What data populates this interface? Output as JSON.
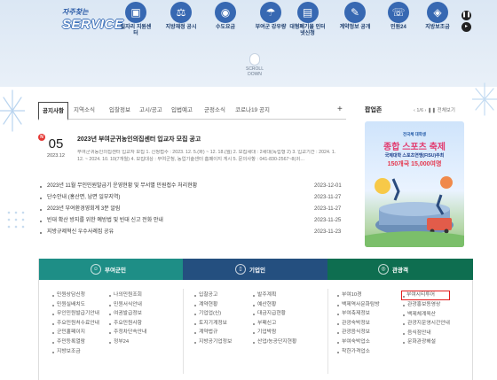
{
  "service": {
    "logo_small": "자주찾는",
    "logo_big": "SERVICE",
    "items": [
      {
        "label": "일자리 지원센터",
        "icon": "briefcase-icon",
        "glyph": "▣"
      },
      {
        "label": "지방재정 공시",
        "icon": "gavel-icon",
        "glyph": "⚖"
      },
      {
        "label": "수도요금",
        "icon": "water-icon",
        "glyph": "◉"
      },
      {
        "label": "부여군 강우량",
        "icon": "rain-icon",
        "glyph": "☂"
      },
      {
        "label": "대형폐기물 인터넷신청",
        "icon": "trash-icon",
        "glyph": "▤"
      },
      {
        "label": "계약정보 공개",
        "icon": "contract-icon",
        "glyph": "✎"
      },
      {
        "label": "민원24",
        "icon": "headset-icon",
        "glyph": "☏"
      },
      {
        "label": "지방보조금",
        "icon": "coin-icon",
        "glyph": "◈"
      }
    ],
    "scroll_label": "SCROLL DOWN",
    "pause_glyph": "❚❚",
    "next_glyph": "▸"
  },
  "notice": {
    "tabs": [
      "공지사항",
      "지역소식",
      "입찰정보",
      "고시/공고",
      "입법예고",
      "군정소식",
      "코로나19 공지"
    ],
    "plus": "+",
    "featured": {
      "badge": "N",
      "day": "05",
      "year_month": "2023.12",
      "title": "2023년 부여군귀농인의집센터 입교자 모집 공고",
      "summary": "부여군귀농인의집센터 입교자 모집 1. 신청접수 : 2023. 12. 5.(화) ~ 12. 18.(월) 2. 모집세대 : 2세대(독립형 2) 3. 입교기간 : 2024. 1. 12. ~ 2024. 10. 10(7개월) 4. 모집대상 : 부여군청, 농업기술센터 홈페이지 게시 5. 문의사항 : 041-830-2567~8(귀…"
    },
    "items": [
      {
        "title": "2023년 11월 무인민원발급기 운영현황 및 무서별 민원접수 처리현황",
        "date": "2023-12-01"
      },
      {
        "title": "단수안내 (홍산면, 남면 일부지역)",
        "date": "2023-11-27"
      },
      {
        "title": "2023년 부여환경영회계 3분 알림",
        "date": "2023-11-27"
      },
      {
        "title": "빈대 확산 방지를 위한 예방법 및 빈대 신고 전화 안내",
        "date": "2023-11-25"
      },
      {
        "title": "지방규제혁신 우수사례집 공유",
        "date": "2023-11-23"
      }
    ]
  },
  "popup": {
    "title": "팝업존",
    "nav": "‹ 1/6 › ❚❚ 전체보기",
    "sub": "전국체 대학생",
    "headline": "종합 스포츠 축제",
    "line": "국제대학 스포츠연맹(FISU)주최",
    "prize": "150개국 15,000여명",
    "colors": {
      "pink": "#e23b6f",
      "blue": "#1d56a5",
      "green": "#8bc27f"
    }
  },
  "categories": {
    "resident": {
      "label": "부여군민",
      "icon": "people-icon",
      "color": "#1e8e86",
      "col1": [
        "민원상담신청",
        "민원실배치도",
        "무인민원발급기안내",
        "주요민원처수료안내",
        "군민홀페이지",
        "주민등록열람",
        "지방보조금"
      ],
      "col2": [
        "나의민원조회",
        "민원서식안내",
        "여권발급정보",
        "주요민원사항",
        "주정차단속안내",
        "정부24"
      ]
    },
    "business": {
      "label": "기업인",
      "icon": "building-icon",
      "color": "#244f7f",
      "col1": [
        "입찰공고",
        "계약현황",
        "기업업(신)",
        "토지기계정보",
        "계약법규",
        "지방공기업정보"
      ],
      "col2": [
        "발주계획",
        "예산현황",
        "대금지급현황",
        "부패신고",
        "기업박람",
        "산업/농공단지현황"
      ]
    },
    "tourist": {
      "label": "관광객",
      "icon": "camera-icon",
      "color": "#0e6e50",
      "col1": [
        "부여10경",
        "백제역사문화탐방",
        "부여축제정보",
        "관광숙박정보",
        "관광음식정보",
        "부여숙박업소",
        "착한가격업소"
      ],
      "col2": [
        "부여시티투어",
        "관광홍보동영상",
        "백제체계육산",
        "관광지운영시간안내",
        "음식점안내",
        "문화관광해설"
      ]
    }
  }
}
